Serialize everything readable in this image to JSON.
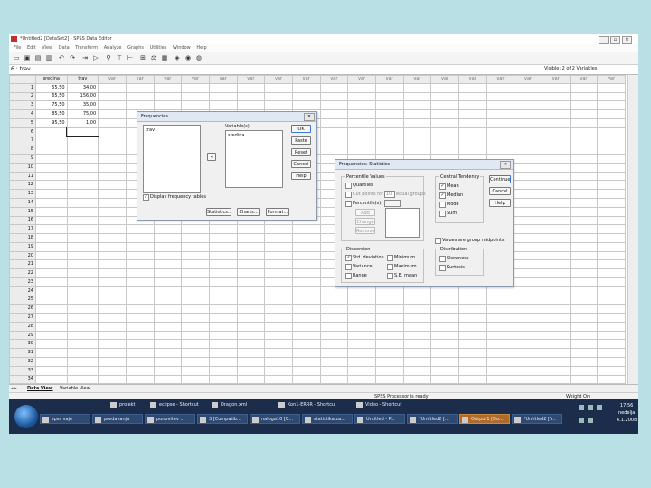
{
  "window": {
    "title": "*Untitled2 [DataSet2] - SPSS Data Editor",
    "menu": [
      "File",
      "Edit",
      "View",
      "Data",
      "Transform",
      "Analyze",
      "Graphs",
      "Utilities",
      "Window",
      "Help"
    ]
  },
  "cellbar": {
    "ref": "6 : trav",
    "visible": "Visible: 2 of 2 Variables"
  },
  "grid": {
    "columns": [
      "sredina",
      "trav",
      "var",
      "var",
      "var",
      "var",
      "var",
      "var",
      "var",
      "var",
      "var",
      "var",
      "var",
      "var",
      "var",
      "var",
      "var",
      "var",
      "var",
      "var",
      "var"
    ],
    "rows": [
      [
        "55,50",
        "34,00"
      ],
      [
        "65,50",
        "156,00"
      ],
      [
        "75,50",
        "35,00"
      ],
      [
        "85,50",
        "75,00"
      ],
      [
        "95,50",
        "1,00"
      ]
    ],
    "row_count": 37
  },
  "tabs": {
    "data_view": "Data View",
    "variable_view": "Variable View"
  },
  "status": {
    "processor": "SPSS Processor is ready",
    "weight": "Weight On"
  },
  "frequencies": {
    "title": "Frequencies",
    "source_item": "trav",
    "variables_label": "Variable(s):",
    "variables_item": "sredina",
    "display_tables": "Display frequency tables",
    "buttons": {
      "ok": "OK",
      "paste": "Paste",
      "reset": "Reset",
      "cancel": "Cancel",
      "help": "Help"
    },
    "bottom_buttons": {
      "statistics": "Statistics...",
      "charts": "Charts...",
      "format": "Format..."
    }
  },
  "statistics": {
    "title": "Frequencies: Statistics",
    "percentile_values": {
      "label": "Percentile Values",
      "quartiles": "Quartiles",
      "cut_points": "Cut points for",
      "cut_value": "10",
      "equal_groups": "equal groups",
      "percentiles": "Percentile(s):",
      "add": "Add",
      "change": "Change",
      "remove": "Remove"
    },
    "central_tendency": {
      "label": "Central Tendency",
      "mean": "Mean",
      "median": "Median",
      "mode": "Mode",
      "sum": "Sum"
    },
    "group_midpoints": "Values are group midpoints",
    "dispersion": {
      "label": "Dispersion",
      "std": "Std. deviation",
      "variance": "Variance",
      "range": "Range",
      "minimum": "Minimum",
      "maximum": "Maximum",
      "se_mean": "S.E. mean"
    },
    "distribution": {
      "label": "Distribution",
      "skewness": "Skewness",
      "kurtosis": "Kurtosis"
    },
    "buttons": {
      "continue": "Continue",
      "cancel": "Cancel",
      "help": "Help"
    }
  },
  "taskbar": {
    "top_row": [
      "projekt",
      "eclipse - Shortcut",
      "Dragon.xml",
      "Kon1-ERRR - Shortcut",
      "Video - Shortcut"
    ],
    "items": [
      "spss vaje",
      "predavanja",
      "ponovitev ...",
      "3 [Compatib...",
      "naloga10 [C...",
      "statistika za...",
      "Untitled - P...",
      "*Untitled2 [...",
      "Output1 [Do...",
      "*Untitled2 [Y..."
    ],
    "clock": {
      "time": "17:56",
      "day": "nedelja",
      "date": "6.1.2008"
    }
  },
  "colors": {
    "desktop": "#b9e0e4",
    "taskbar": "#1b2d4a",
    "active_task": "#b06a2a"
  }
}
